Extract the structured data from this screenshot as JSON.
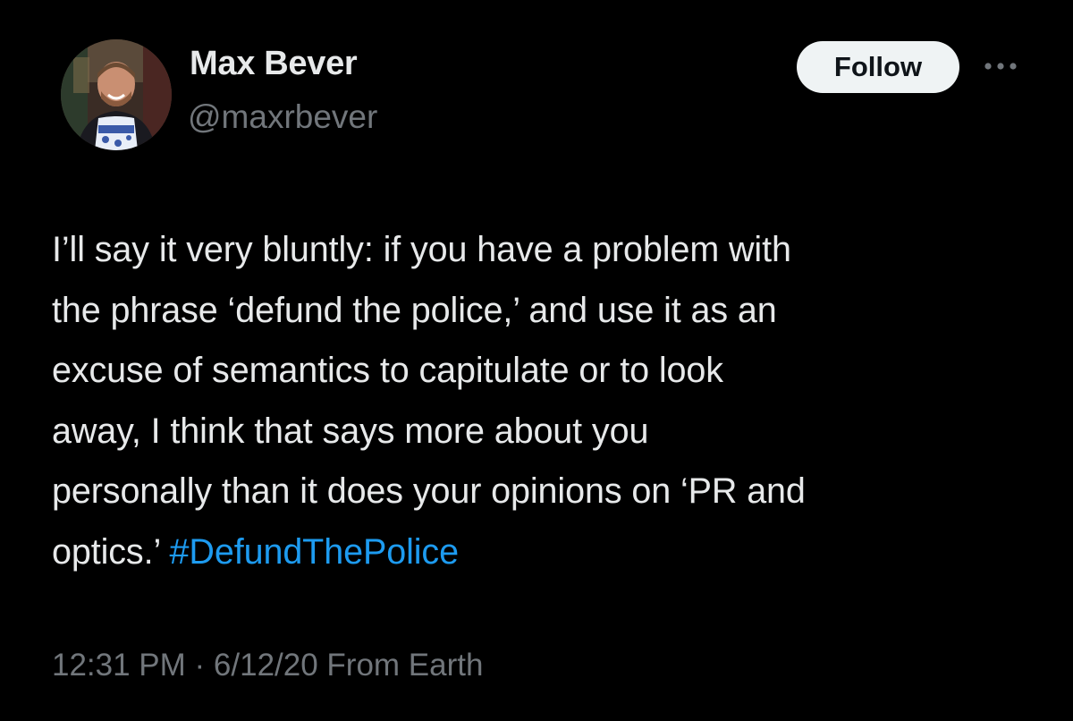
{
  "author": {
    "name": "Max Bever",
    "handle": "@maxrbever"
  },
  "actions": {
    "follow_label": "Follow",
    "more_icon": "more-horizontal-icon"
  },
  "tweet": {
    "lines": [
      "I’ll say it very bluntly: if you have a problem with",
      "the phrase ‘defund the police,’ and use it as an",
      "excuse of semantics to capitulate or to look",
      "away, I think that says more about you",
      "personally than it does your opinions on ‘PR and"
    ],
    "last_line_prefix": "optics.’ ",
    "hashtag": "#DefundThePolice"
  },
  "meta": {
    "time": "12:31 PM",
    "separator": " · ",
    "date": "6/12/20",
    "source": " From Earth"
  },
  "colors": {
    "background": "#000000",
    "text": "#e7e9ea",
    "secondary": "#71767b",
    "link": "#1d9bf0",
    "follow_bg": "#eff3f4"
  }
}
